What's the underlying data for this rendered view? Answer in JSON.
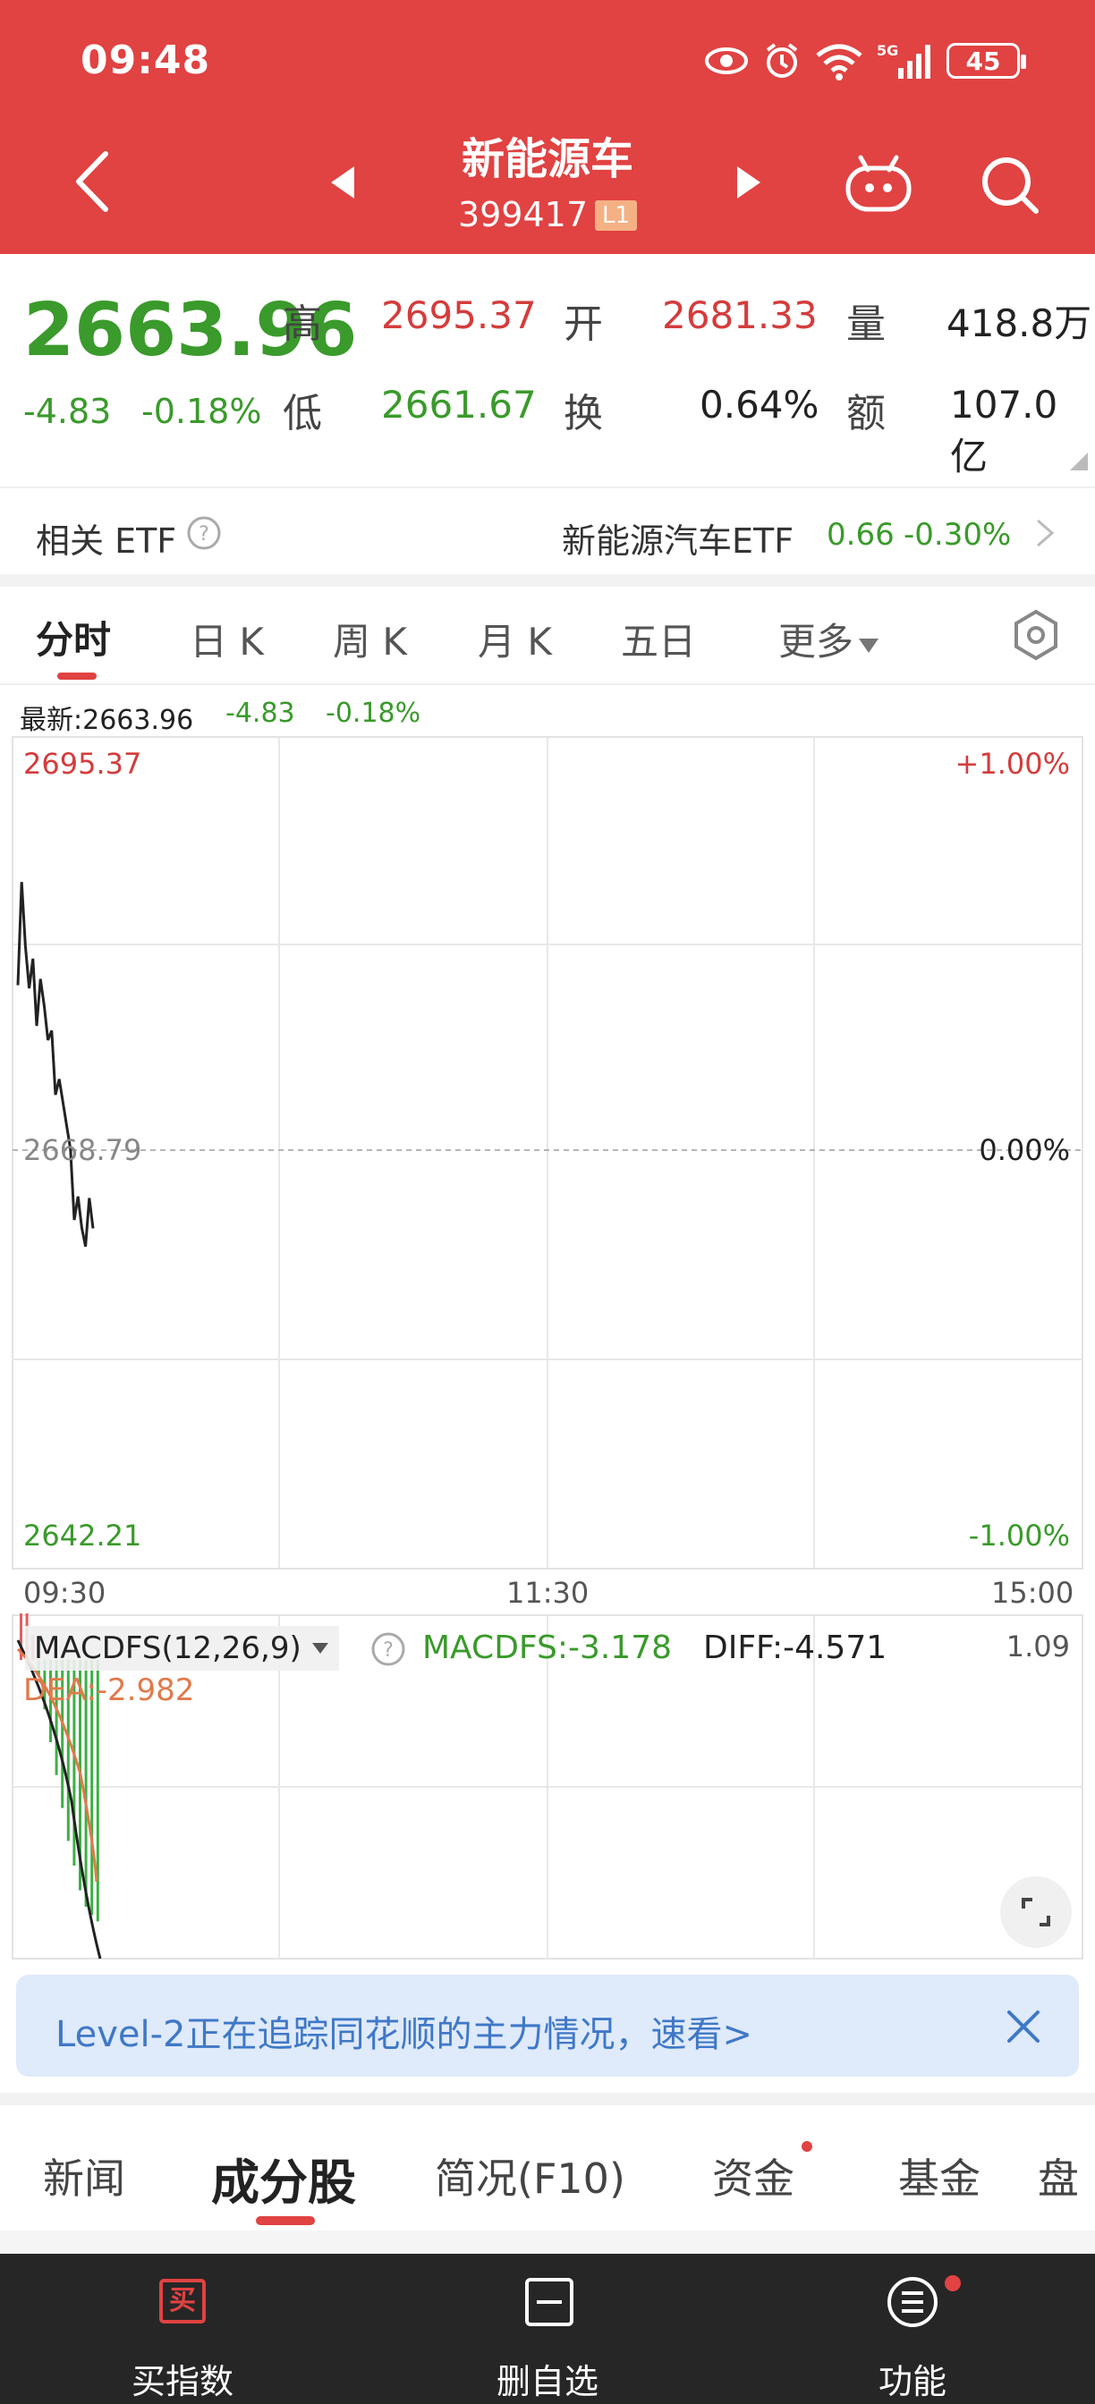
{
  "status_bar": {
    "time": "09:48",
    "battery": "45",
    "network": "5G"
  },
  "header": {
    "title": "新能源车",
    "code": "399417",
    "badge": "L1"
  },
  "quote": {
    "price": "2663.96",
    "change": "-4.83",
    "change_pct": "-0.18%",
    "high_label": "高",
    "high": "2695.37",
    "open_label": "开",
    "open": "2681.33",
    "volume_label": "量",
    "volume": "418.8万",
    "low_label": "低",
    "low": "2661.67",
    "turnover_label": "换",
    "turnover": "0.64%",
    "amount_label": "额",
    "amount": "107.0亿"
  },
  "etf": {
    "label": "相关 ETF",
    "name": "新能源汽车ETF",
    "price": "0.66",
    "pct": "-0.30%"
  },
  "tabs": [
    {
      "label": "分时"
    },
    {
      "label": "日 K"
    },
    {
      "label": "周 K"
    },
    {
      "label": "月 K"
    },
    {
      "label": "五日"
    },
    {
      "label": "更多"
    }
  ],
  "intraday": {
    "latest_label": "最新:2663.96",
    "latest_change": "-4.83",
    "latest_pct": "-0.18%",
    "top_price": "2695.37",
    "top_pct": "+1.00%",
    "mid_price": "2668.79",
    "mid_pct": "0.00%",
    "bottom_price": "2642.21",
    "bottom_pct": "-1.00%",
    "times": [
      "09:30",
      "11:30",
      "15:00"
    ]
  },
  "macd": {
    "selector": "MACDFS(12,26,9)",
    "macdfs": "MACDFS:-3.178",
    "diff": "DIFF:-4.571",
    "dea": "DEA:-2.982",
    "scale_top": "1.09"
  },
  "chart_data": [
    {
      "type": "line",
      "title": "",
      "series": [
        {
          "values": [
            2679.5,
            2686.1,
            2682.0,
            2679.3,
            2681.2,
            2676.9,
            2679.9,
            2678.2,
            2676.0,
            2676.6,
            2672.5,
            2673.5,
            2672.0,
            2670.5,
            2669.0,
            2664.5,
            2666.0,
            2664.0,
            2662.8,
            2665.9,
            2663.96
          ]
        }
      ],
      "ylim": [
        2642.21,
        2695.37
      ],
      "x_ticks": [
        "09:30",
        "11:30",
        "15:00"
      ]
    },
    {
      "type": "bar",
      "series": [
        {
          "name": "MACDFS",
          "values": [
            0.8,
            0.6,
            0.3,
            -0.2,
            -0.6,
            -1.0,
            -1.4,
            -1.8,
            -2.2,
            -2.5,
            -2.8,
            -3.0,
            -3.1,
            -3.178
          ]
        }
      ]
    }
  ],
  "banner": {
    "text": "Level-2正在追踪同花顺的主力情况，速看>"
  },
  "bottom_tabs": [
    {
      "label": "新闻"
    },
    {
      "label": "成分股"
    },
    {
      "label": "简况(F10)"
    },
    {
      "label": "资金"
    },
    {
      "label": "基金"
    },
    {
      "label": "盘"
    }
  ],
  "bottom_nav": [
    {
      "label": "买指数",
      "icon_text": "买"
    },
    {
      "label": "删自选"
    },
    {
      "label": "功能"
    }
  ]
}
